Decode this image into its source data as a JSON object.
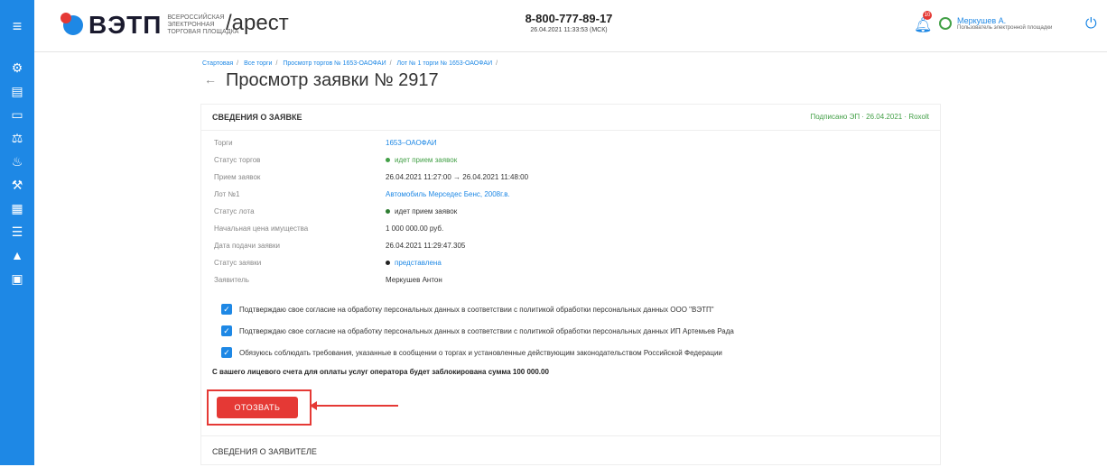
{
  "header": {
    "logo_text": "ВЭТП",
    "logo_sub": "ВСЕРОССИЙСКАЯ ЭЛЕКТРОННАЯ ТОРГОВАЯ ПЛОЩАДКА",
    "section": "/арест",
    "phone": "8-800-777-89-17",
    "datetime": "26.04.2021 11:33:53 (МСК)",
    "notifications_count": "10",
    "user_name": "Меркушев А.",
    "user_role": "Пользователь электронной площадки"
  },
  "breadcrumbs": [
    "Стартовая",
    "Все торги",
    "Просмотр торгов № 1653-ОАОФАИ",
    "Лот № 1 торги № 1653-ОАОФАИ"
  ],
  "page_title": "Просмотр заявки № 2917",
  "card": {
    "title": "СВЕДЕНИЯ О ЗАЯВКЕ",
    "signed": "Подписано ЭП · 26.04.2021 · Roxolt",
    "rows": [
      {
        "label": "Торги",
        "value": "1653–ОАОФАИ"
      },
      {
        "label": "Статус торгов",
        "value": "идет прием заявок"
      },
      {
        "label": "Прием заявок",
        "value": "26.04.2021 11:27:00 → 26.04.2021 11:48:00"
      },
      {
        "label": "Лот №1",
        "value": "Автомобиль Мерседес Бенс, 2008г.в."
      },
      {
        "label": "Статус лота",
        "value": "идет прием заявок"
      },
      {
        "label": "Начальная цена имущества",
        "value": "1 000 000.00 руб."
      },
      {
        "label": "Дата подачи заявки",
        "value": "26.04.2021 11:29:47.305"
      },
      {
        "label": "Статус заявки",
        "value": "представлена"
      },
      {
        "label": "Заявитель",
        "value": "Меркушев Антон"
      }
    ],
    "consents": [
      "Подтверждаю свое согласие на обработку персональных данных в соответствии с политикой обработки персональных данных ООО \"ВЭТП\"",
      "Подтверждаю свое согласие на обработку персональных данных в соответствии с политикой обработки персональных данных ИП Артемьев Рада",
      "Обязуюсь соблюдать требования, указанные в сообщении о торгах и установленные действующим законодательством Российской Федерации"
    ],
    "note": "С вашего лицевого счета для оплаты услуг оператора будет заблокирована сумма 100 000.00",
    "withdraw_label": "ОТОЗВАТЬ"
  },
  "card2_title": "СВЕДЕНИЯ О ЗАЯВИТЕЛЕ",
  "colors": {
    "accent": "#1e88e5",
    "danger": "#e53935",
    "success": "#43a047"
  }
}
